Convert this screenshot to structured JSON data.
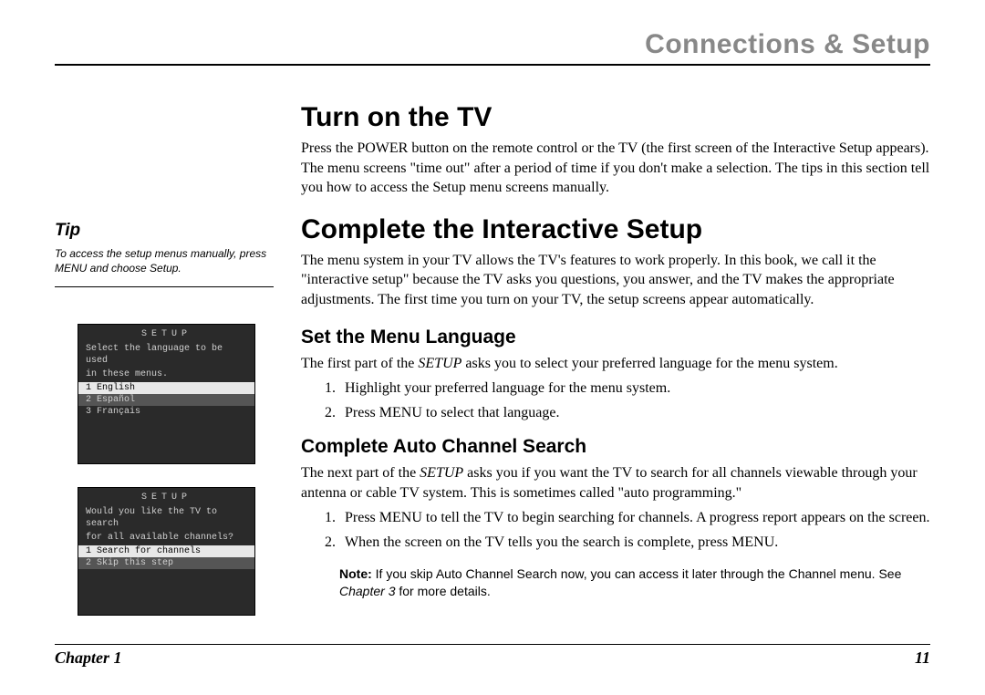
{
  "header": {
    "title": "Connections & Setup"
  },
  "sidebar": {
    "tip_heading": "Tip",
    "tip_body": "To access the setup menus manually, press MENU and choose Setup.",
    "screenshot1": {
      "title": "SETUP",
      "prompt1": "Select the language to be used",
      "prompt2": "in these menus.",
      "opt1": "1 English",
      "opt2": "2 Español",
      "opt3": "3 Français"
    },
    "screenshot2": {
      "title": "SETUP",
      "prompt1": "Would you like the TV to search",
      "prompt2": "for all available channels?",
      "opt1": "1 Search for channels",
      "opt2": "2 Skip this step"
    }
  },
  "main": {
    "s1": {
      "heading": "Turn on the TV",
      "body": "Press the POWER button on the remote control or the TV (the first screen of the Interactive Setup appears). The menu screens \"time out\" after a period of time if you don't make a selection. The tips in this section tell you how to access the Setup menu screens manually."
    },
    "s2": {
      "heading": "Complete the Interactive Setup",
      "body": "The menu system in your TV allows the TV's features to work properly. In this book, we call it the \"interactive setup\" because the TV asks you questions, you answer, and the TV makes the appropriate adjustments. The first time you turn on your TV, the setup screens appear automatically."
    },
    "s3": {
      "heading": "Set the Menu Language",
      "body_pre": "The first part of the ",
      "body_em": "SETUP",
      "body_post": " asks you to select your preferred language for the menu system.",
      "li1": "Highlight your preferred language for the menu system.",
      "li2": "Press MENU to select that language."
    },
    "s4": {
      "heading": "Complete Auto Channel Search",
      "body_pre": "The next part of the ",
      "body_em": "SETUP",
      "body_post": " asks you if you want the TV to search for all channels viewable through your antenna or cable TV system. This is sometimes called \"auto programming.\"",
      "li1": "Press MENU to tell the TV to begin searching for channels. A progress report appears on the screen.",
      "li2": "When the screen on the TV tells you the search is complete, press MENU.",
      "note_label": "Note:",
      "note_pre": " If you skip Auto Channel Search now, you can access it later through the Channel menu. See ",
      "note_em": "Chapter 3",
      "note_post": " for more details."
    }
  },
  "footer": {
    "chapter": "Chapter 1",
    "page": "11"
  }
}
